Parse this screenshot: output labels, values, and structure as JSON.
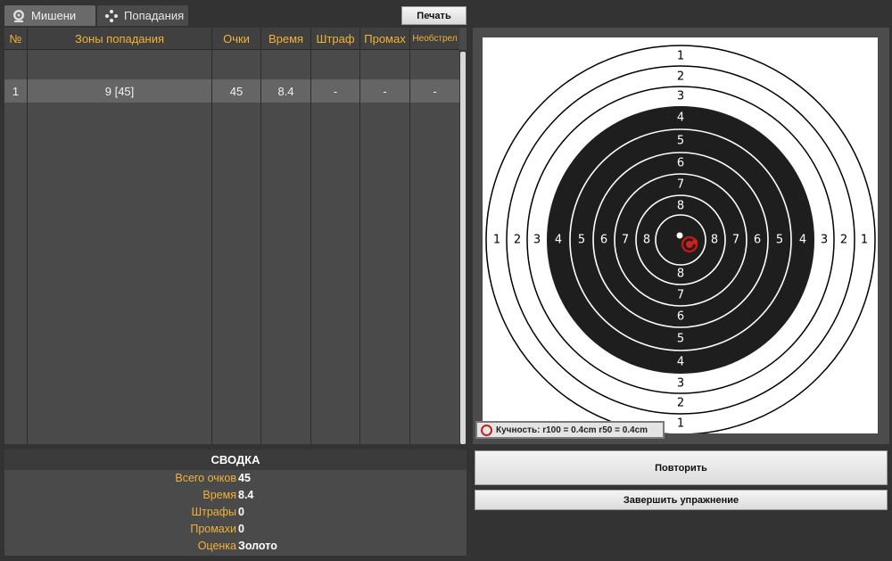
{
  "tabs": [
    {
      "label": "Мишени",
      "icon": "target-icon",
      "active": true
    },
    {
      "label": "Попадания",
      "icon": "hits-icon",
      "active": false
    }
  ],
  "toolbar": {
    "print_label": "Печать"
  },
  "table": {
    "headers": [
      "№",
      "Зоны попадания",
      "Очки",
      "Время",
      "Штраф",
      "Промах",
      "Необстрел"
    ],
    "rows": [
      [
        "1",
        "9 [45]",
        "45",
        "8.4",
        "-",
        "-",
        "-"
      ]
    ]
  },
  "summary": {
    "title": "СВОДКА",
    "items": [
      {
        "label": "Всего очков",
        "value": "45"
      },
      {
        "label": "Время",
        "value": "8.4"
      },
      {
        "label": "Штрафы",
        "value": "0"
      },
      {
        "label": "Промахи",
        "value": "0"
      },
      {
        "label": "Оценка",
        "value": "Золото"
      }
    ]
  },
  "target": {
    "grouping": "Кучность: r100 = 0.4cm  r50 = 0.4cm",
    "ring_numbers": [
      "1",
      "2",
      "3",
      "4",
      "5",
      "6",
      "7",
      "8"
    ]
  },
  "buttons": {
    "repeat": "Повторить",
    "finish": "Завершить упражнение"
  },
  "colors": {
    "accent": "#f0b23a",
    "hit": "#d02020",
    "background": "#333333"
  }
}
